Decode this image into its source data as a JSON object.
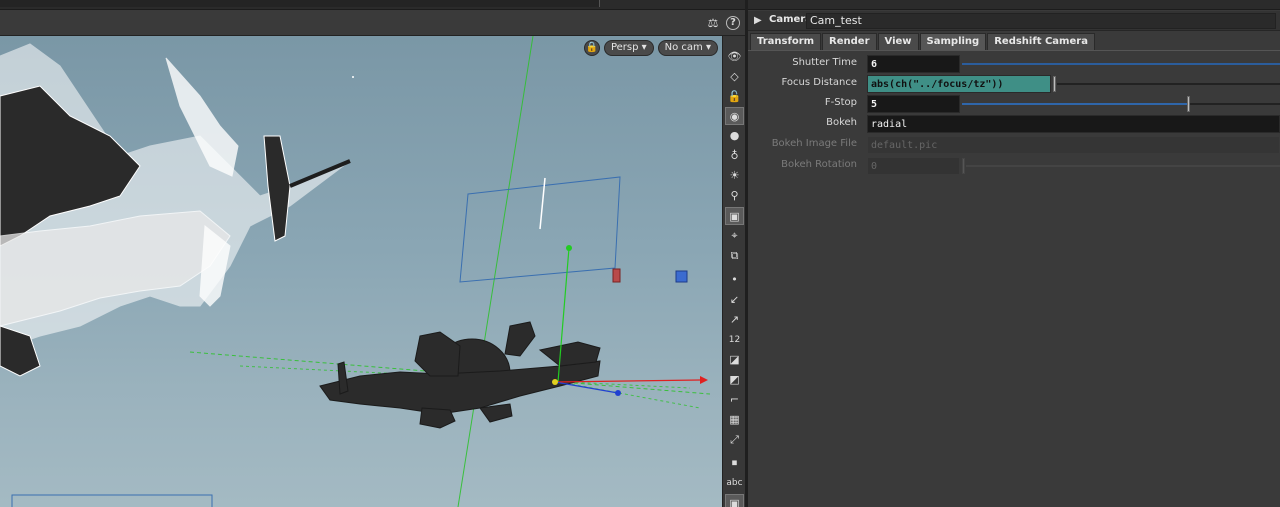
{
  "viewport": {
    "view_menu": "Persp",
    "camera_menu": "No cam",
    "help": "?",
    "side_tool_text": "abc",
    "side_tool_num": "12"
  },
  "node": {
    "type": "Camera",
    "name": "Cam_test"
  },
  "tabs": [
    "Transform",
    "Render",
    "View",
    "Sampling",
    "Redshift Camera"
  ],
  "params": {
    "shutter_time": {
      "label": "Shutter Time",
      "value": "6",
      "slider_fraction": 0.0
    },
    "focus_distance": {
      "label": "Focus Distance",
      "value": "abs(ch(\"../focus/tz\"))"
    },
    "f_stop": {
      "label": "F-Stop",
      "value": "5",
      "slider_fraction": 0.71
    },
    "bokeh": {
      "label": "Bokeh",
      "value": "radial"
    },
    "bokeh_image_file": {
      "label": "Bokeh Image File",
      "value": "default.pic"
    },
    "bokeh_rotation": {
      "label": "Bokeh Rotation",
      "value": "0"
    }
  },
  "colors": {
    "expression_field": "#3f8f86",
    "slider": "#2f66aa",
    "viewport_sky": "#8aa6b4",
    "axis_x": "#e02020",
    "axis_y": "#20c020",
    "axis_z": "#2040d0"
  }
}
